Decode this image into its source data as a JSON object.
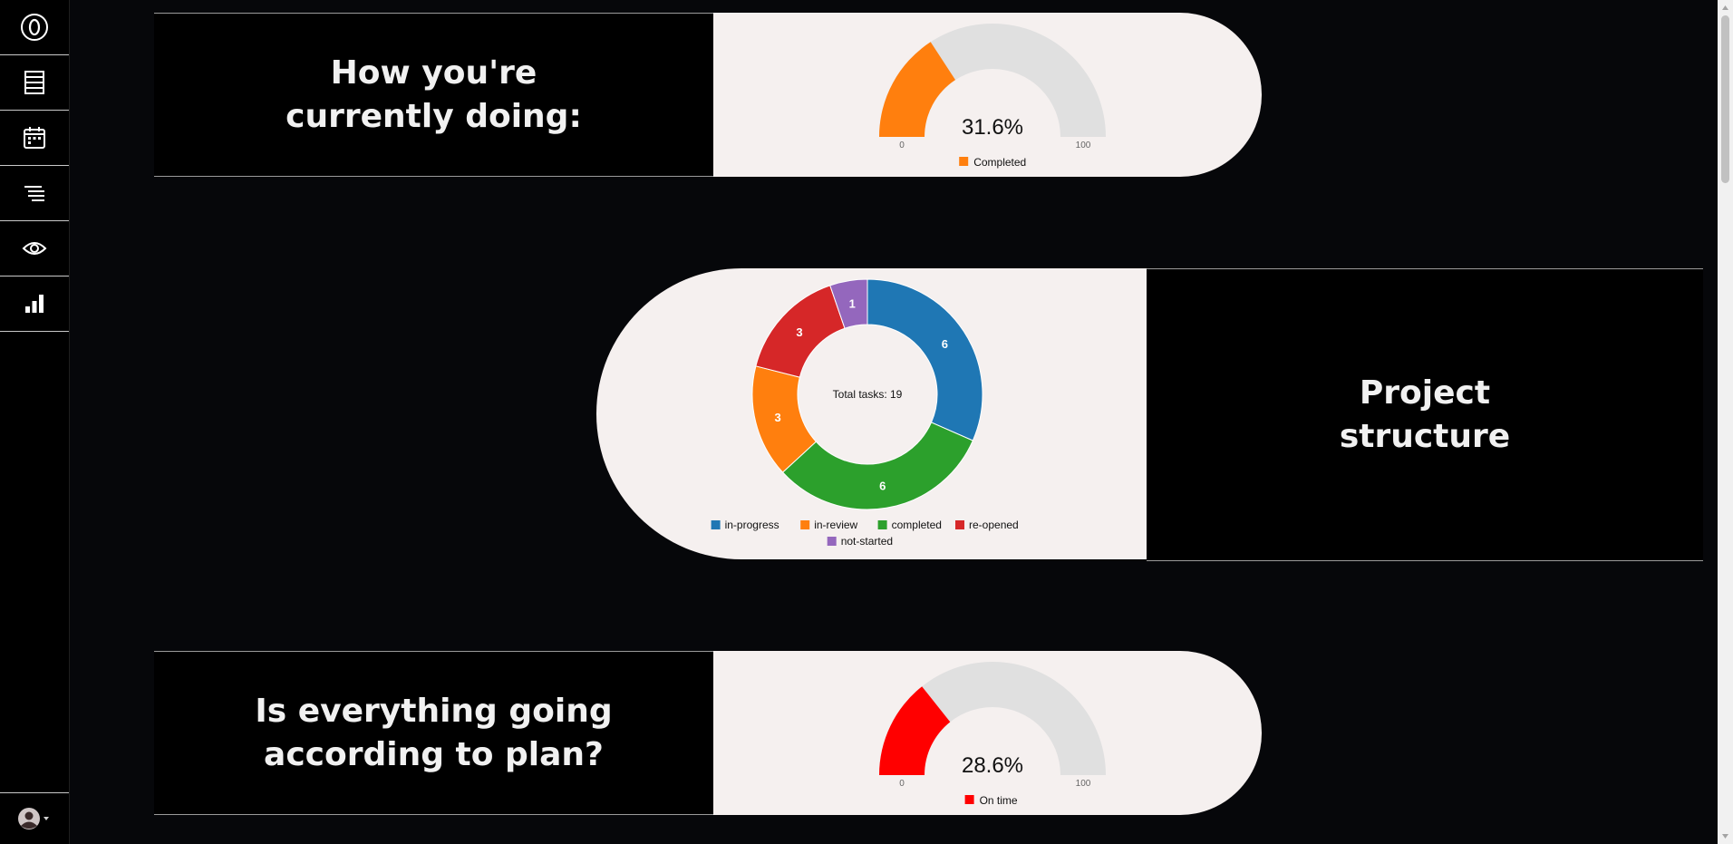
{
  "sidebar": {
    "items": [
      {
        "icon": "logo-zero-icon"
      },
      {
        "icon": "board-icon"
      },
      {
        "icon": "calendar-icon"
      },
      {
        "icon": "list-lines-icon"
      },
      {
        "icon": "eye-icon"
      },
      {
        "icon": "bar-chart-icon"
      }
    ],
    "user_icon": "user-avatar-icon"
  },
  "panels": {
    "progress": {
      "title_line1": "How you're",
      "title_line2": "currently doing:"
    },
    "structure": {
      "title_line1": "Project",
      "title_line2": "structure"
    },
    "schedule": {
      "title_line1": "Is everything going",
      "title_line2": "according to plan?"
    }
  },
  "colors": {
    "gauge_completed": "#ff7f0e",
    "gauge_on_time": "#ff0000",
    "gauge_track": "#e0e0e0",
    "in_progress": "#1f77b4",
    "in_review": "#ff7f0e",
    "completed": "#2ca02c",
    "re_opened": "#d62728",
    "not_started": "#9467bd"
  },
  "chart_data": [
    {
      "type": "gauge",
      "value": 31.6,
      "value_label": "31.6%",
      "min": 0,
      "max": 100,
      "min_label": "0",
      "max_label": "100",
      "legend": "Completed"
    },
    {
      "type": "pie",
      "donut": true,
      "center_label": "Total tasks: 19",
      "categories": [
        "in-progress",
        "in-review",
        "completed",
        "re-opened",
        "not-started"
      ],
      "display_order": [
        "in-progress",
        "completed",
        "in-review",
        "re-opened",
        "not-started"
      ],
      "values": {
        "in-progress": 6,
        "completed": 6,
        "in-review": 3,
        "re-opened": 3,
        "not-started": 1
      },
      "legend_placement": "bottom"
    },
    {
      "type": "gauge",
      "value": 28.6,
      "value_label": "28.6%",
      "min": 0,
      "max": 100,
      "min_label": "0",
      "max_label": "100",
      "legend": "On time"
    }
  ]
}
